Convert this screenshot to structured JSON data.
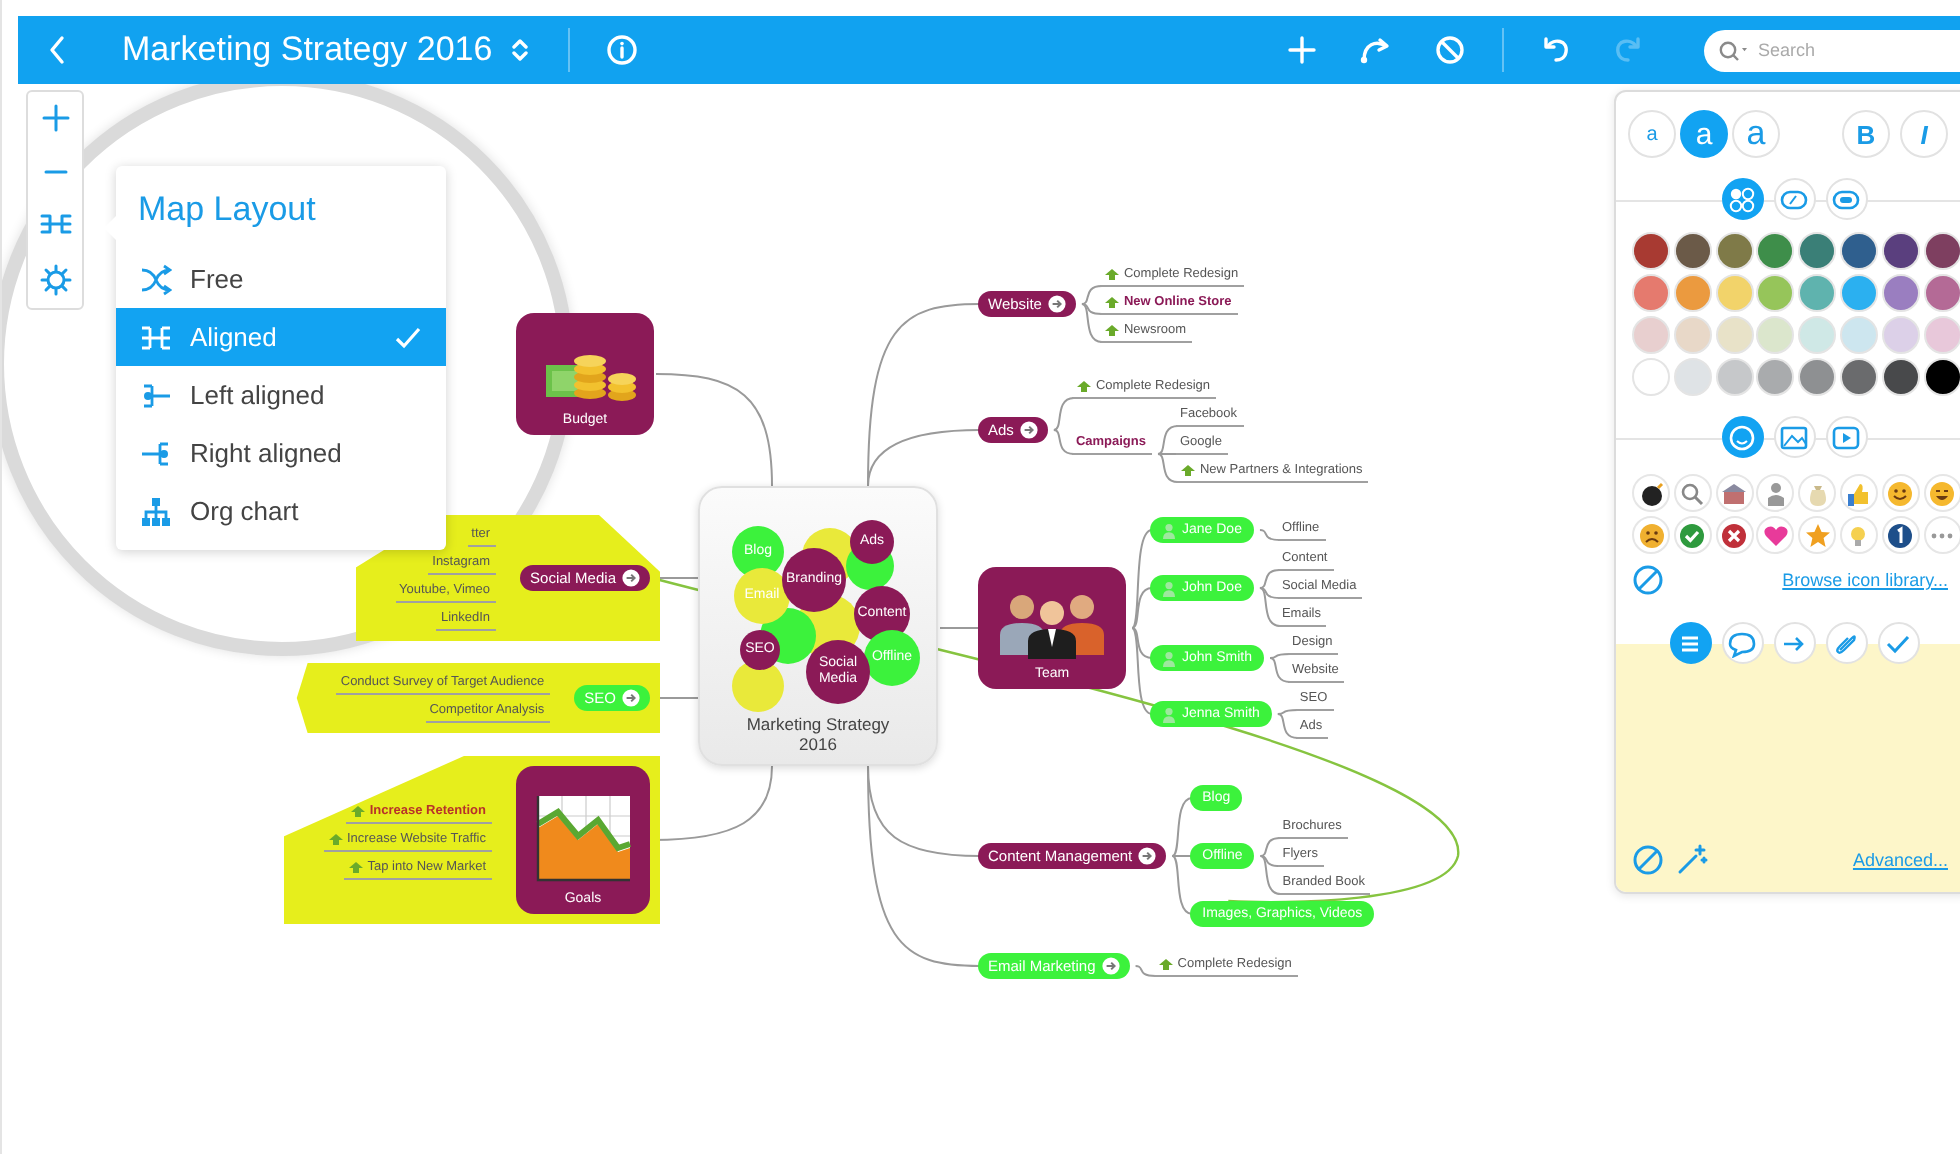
{
  "toolbar": {
    "title": "Marketing Strategy 2016",
    "redo": {
      "disabled": true
    },
    "search": {
      "placeholder": "Search"
    }
  },
  "layout_menu": {
    "title": "Map Layout",
    "items": [
      {
        "label": "Free",
        "selected": false
      },
      {
        "label": "Aligned",
        "selected": true
      },
      {
        "label": "Left aligned",
        "selected": false
      },
      {
        "label": "Right aligned",
        "selected": false
      },
      {
        "label": "Org chart",
        "selected": false
      }
    ]
  },
  "map": {
    "central": {
      "title": "Marketing Strategy 2016",
      "bubbles": [
        {
          "color": "#e9e93a"
        },
        {
          "color": "#3cf23c"
        },
        {
          "color": "#e9e93a"
        },
        {
          "color": "#3cf23c"
        },
        {
          "color": "#e9e93a"
        },
        {
          "label": "Blog",
          "color": "#3cf23c"
        },
        {
          "label": "Email",
          "color": "#e9e93a"
        },
        {
          "label": "Branding",
          "color": "#8b1a57"
        },
        {
          "label": "Ads",
          "color": "#8b1a57"
        },
        {
          "label": "Content",
          "color": "#8b1a57"
        },
        {
          "label": "Offline",
          "color": "#3cf23c"
        },
        {
          "label": "SEO",
          "color": "#8b1a57"
        },
        {
          "label": "Social Media",
          "color": "#8b1a57"
        }
      ]
    },
    "branches": [
      {
        "kind": "image",
        "label": "Budget",
        "color": "#8b1a57",
        "highlight": false,
        "arrow": false
      },
      {
        "kind": "pill",
        "label": "Social Media",
        "color": "#8b1a57",
        "highlight": true,
        "arrow": true,
        "cross_link": true,
        "children": [
          {
            "kind": "text",
            "label": "tter",
            "icon": false,
            "bold": false
          },
          {
            "kind": "text",
            "label": "Instagram",
            "icon": false,
            "bold": false
          },
          {
            "kind": "text",
            "label": "Youtube, Vimeo",
            "icon": false,
            "bold": false
          },
          {
            "kind": "text",
            "label": "LinkedIn",
            "icon": false,
            "bold": false
          }
        ]
      },
      {
        "kind": "pill",
        "label": "SEO",
        "color": "#3cf23c",
        "highlight": true,
        "arrow": true,
        "children": [
          {
            "kind": "text",
            "label": "Conduct Survey of Target Audience",
            "icon": false,
            "bold": false
          },
          {
            "kind": "text",
            "label": "Competitor Analysis",
            "icon": false,
            "bold": false
          }
        ]
      },
      {
        "kind": "image",
        "label": "Goals",
        "color": "#8b1a57",
        "highlight": true,
        "arrow": false,
        "children": [
          {
            "kind": "text",
            "label": "Increase Retention",
            "icon": true,
            "bold": true,
            "color": "#b8322a"
          },
          {
            "kind": "text",
            "label": "Increase Website Traffic",
            "icon": true,
            "bold": false
          },
          {
            "kind": "text",
            "label": "Tap into New Market",
            "icon": true,
            "bold": false
          }
        ]
      },
      {
        "kind": "pill",
        "label": "Website",
        "color": "#8b1a57",
        "highlight": false,
        "arrow": true,
        "children": [
          {
            "kind": "text",
            "label": "Complete Redesign",
            "icon": true,
            "bold": false
          },
          {
            "kind": "text",
            "label": "New Online Store",
            "icon": true,
            "bold": true,
            "color": "#8b1a57"
          },
          {
            "kind": "text",
            "label": "Newsroom",
            "icon": true,
            "bold": false
          }
        ]
      },
      {
        "kind": "pill",
        "label": "Ads",
        "color": "#8b1a57",
        "highlight": false,
        "arrow": true,
        "children": [
          {
            "kind": "text",
            "label": "Complete Redesign",
            "icon": true,
            "bold": false
          },
          {
            "kind": "text",
            "label": "Campaigns",
            "icon": false,
            "bold": true,
            "color": "#8b1a57",
            "children": [
              {
                "kind": "text",
                "label": "Facebook",
                "icon": false,
                "bold": false
              },
              {
                "kind": "text",
                "label": "Google",
                "icon": false,
                "bold": false
              },
              {
                "kind": "text",
                "label": "New Partners & Integrations",
                "icon": true,
                "bold": false
              }
            ]
          }
        ]
      },
      {
        "kind": "image",
        "label": "Team",
        "color": "#8b1a57",
        "highlight": false,
        "arrow": false,
        "children": [
          {
            "kind": "pill",
            "label": "Jane Doe",
            "icon": true,
            "color": "#3cf23c",
            "children": [
              {
                "kind": "text",
                "label": "Offline",
                "icon": false,
                "bold": false
              }
            ]
          },
          {
            "kind": "pill",
            "label": "John Doe",
            "icon": true,
            "color": "#3cf23c",
            "children": [
              {
                "kind": "text",
                "label": "Content",
                "icon": false,
                "bold": false
              },
              {
                "kind": "text",
                "label": "Social Media",
                "icon": false,
                "bold": false
              },
              {
                "kind": "text",
                "label": "Emails",
                "icon": false,
                "bold": false
              }
            ]
          },
          {
            "kind": "pill",
            "label": "John Smith",
            "icon": true,
            "color": "#3cf23c",
            "children": [
              {
                "kind": "text",
                "label": "Design",
                "icon": false,
                "bold": false
              },
              {
                "kind": "text",
                "label": "Website",
                "icon": false,
                "bold": false
              }
            ]
          },
          {
            "kind": "pill",
            "label": "Jenna Smith",
            "icon": true,
            "color": "#3cf23c",
            "children": [
              {
                "kind": "text",
                "label": "SEO",
                "icon": false,
                "bold": false
              },
              {
                "kind": "text",
                "label": "Ads",
                "icon": false,
                "bold": false
              }
            ]
          }
        ]
      },
      {
        "kind": "pill",
        "label": "Content Management",
        "color": "#8b1a57",
        "highlight": false,
        "arrow": true,
        "children": [
          {
            "kind": "pill",
            "label": "Blog",
            "icon": false,
            "color": "#3cf23c"
          },
          {
            "kind": "pill",
            "label": "Offline",
            "icon": false,
            "color": "#3cf23c",
            "children": [
              {
                "kind": "text",
                "label": "Brochures",
                "icon": false,
                "bold": false
              },
              {
                "kind": "text",
                "label": "Flyers",
                "icon": false,
                "bold": false
              },
              {
                "kind": "text",
                "label": "Branded Book",
                "icon": false,
                "bold": false
              }
            ]
          },
          {
            "kind": "pill",
            "label": "Images, Graphics, Videos",
            "icon": false,
            "color": "#3cf23c",
            "cross_link": true
          }
        ]
      },
      {
        "kind": "pill",
        "label": "Email Marketing",
        "color": "#3cf23c",
        "highlight": false,
        "arrow": true,
        "children": [
          {
            "kind": "text",
            "label": "Complete Redesign",
            "icon": true,
            "bold": false
          }
        ]
      }
    ]
  },
  "format_panel": {
    "text_sizes": [
      {
        "label": "a",
        "selected": false
      },
      {
        "label": "a",
        "selected": true
      },
      {
        "label": "a",
        "selected": false
      }
    ],
    "text_styles": [
      {
        "label": "B"
      },
      {
        "label": "I"
      }
    ],
    "fill_tabs": [
      {
        "selected": true
      },
      {
        "selected": false
      },
      {
        "selected": false
      }
    ],
    "swatches": [
      {
        "color": "#a83a32"
      },
      {
        "color": "#6b5a48"
      },
      {
        "color": "#7f7a48"
      },
      {
        "color": "#3e8e4a"
      },
      {
        "color": "#3a7f77"
      },
      {
        "color": "#2f5f8e"
      },
      {
        "color": "#5a3f7e"
      },
      {
        "color": "#7e3f60"
      },
      {
        "color": "#e57a6e"
      },
      {
        "color": "#eb9a3f"
      },
      {
        "color": "#f2d36a"
      },
      {
        "color": "#96c55a"
      },
      {
        "color": "#5fb3ae"
      },
      {
        "color": "#2bb0f0"
      },
      {
        "color": "#9a7ec0"
      },
      {
        "color": "#b46a96"
      },
      {
        "color": "#e8cfcf"
      },
      {
        "color": "#e8d8c8"
      },
      {
        "color": "#e8e2c8"
      },
      {
        "color": "#dbe6cc"
      },
      {
        "color": "#cfe8e6"
      },
      {
        "color": "#cde6ef"
      },
      {
        "color": "#dcd0e8"
      },
      {
        "color": "#e8c8da"
      },
      {
        "color": "#ffffff"
      },
      {
        "color": "#dfe3e6"
      },
      {
        "color": "#c6c8ca"
      },
      {
        "color": "#a9abad"
      },
      {
        "color": "#8e9092"
      },
      {
        "color": "#6a6b6d"
      },
      {
        "color": "#48494b"
      },
      {
        "color": "#000000"
      }
    ],
    "icon_tabs": [
      {
        "selected": true
      },
      {
        "selected": false
      },
      {
        "selected": false
      }
    ],
    "icon_link": "Browse icon library...",
    "note_tabs": [
      {
        "selected": true
      },
      {
        "selected": false
      },
      {
        "selected": false
      },
      {
        "selected": false
      },
      {
        "selected": false
      }
    ],
    "advanced_link": "Advanced..."
  }
}
